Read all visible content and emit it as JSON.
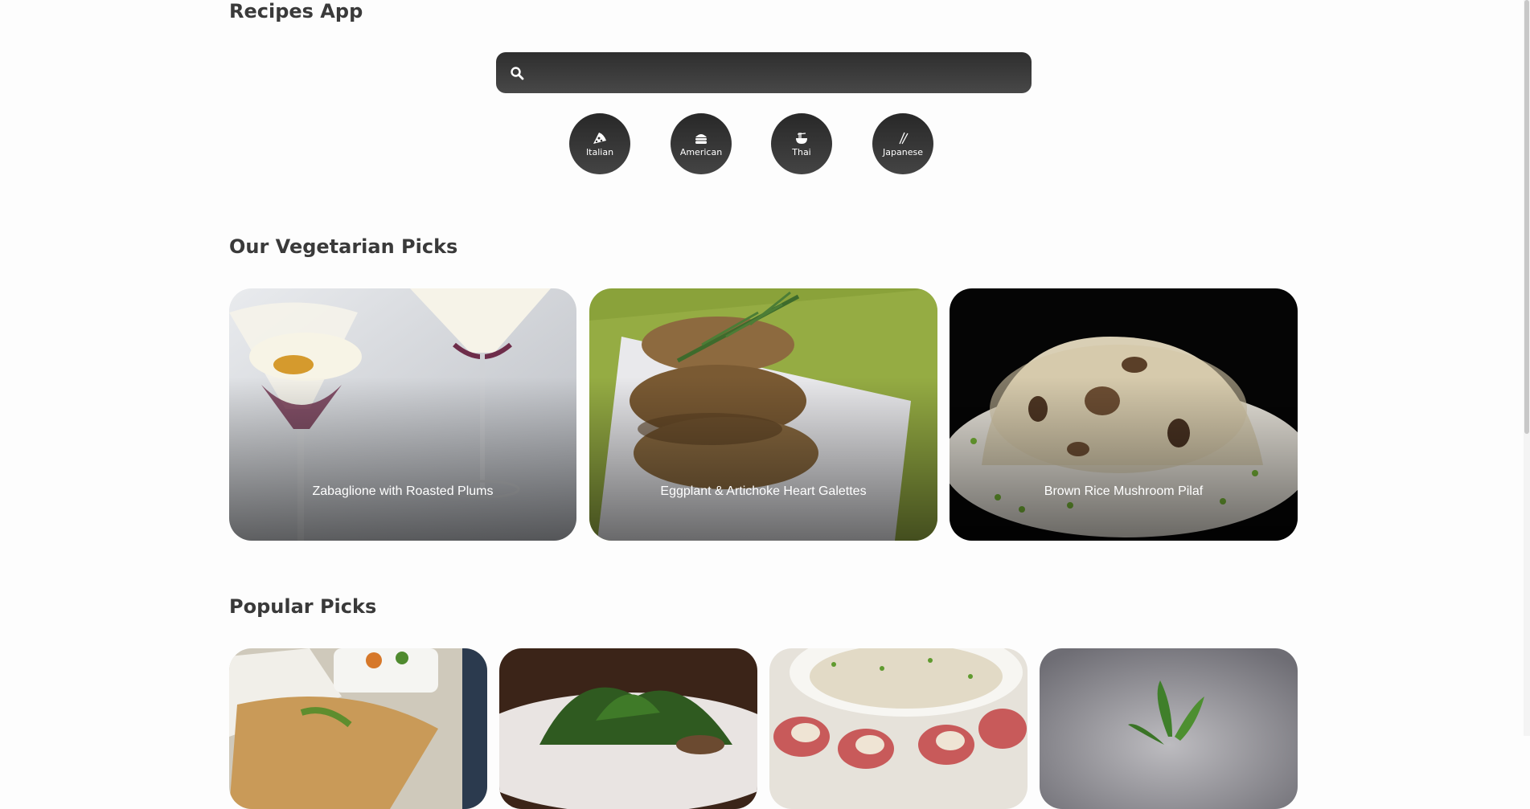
{
  "app": {
    "title": "Recipes App"
  },
  "search": {
    "placeholder": "",
    "value": ""
  },
  "categories": [
    {
      "label": "Italian",
      "icon": "pizza-icon"
    },
    {
      "label": "American",
      "icon": "burger-icon"
    },
    {
      "label": "Thai",
      "icon": "noodle-bowl-icon"
    },
    {
      "label": "Japanese",
      "icon": "chopsticks-icon"
    }
  ],
  "vegetarian": {
    "title": "Our Vegetarian Picks",
    "cards": [
      {
        "title": "Zabaglione with Roasted Plums"
      },
      {
        "title": "Eggplant & Artichoke Heart Galettes"
      },
      {
        "title": "Brown Rice Mushroom Pilaf"
      }
    ]
  },
  "popular": {
    "title": "Popular Picks"
  },
  "colors": {
    "accent": "#333333",
    "background": "#fdfdfd"
  }
}
